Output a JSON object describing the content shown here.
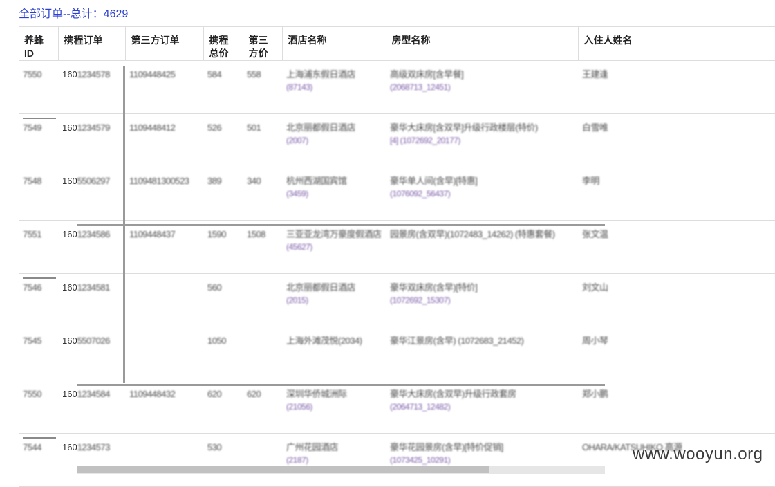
{
  "header": {
    "title_prefix": "全部订单--总计：",
    "total": "4629"
  },
  "table": {
    "columns": [
      {
        "key": "yf_id",
        "label": "养蜂ID"
      },
      {
        "key": "ctrip_order",
        "label": "携程订单"
      },
      {
        "key": "third_order",
        "label": "第三方订单"
      },
      {
        "key": "ctrip_total",
        "label": "携程总价"
      },
      {
        "key": "third_price",
        "label": "第三方价"
      },
      {
        "key": "hotel_name",
        "label": "酒店名称"
      },
      {
        "key": "room_type",
        "label": "房型名称"
      },
      {
        "key": "guest_name",
        "label": "入住人姓名"
      }
    ],
    "rows": [
      {
        "yf_id": "7550",
        "ctrip_prefix": "160",
        "ctrip_rest": "1234578",
        "third_order": "1109448425",
        "ctrip_total": "584",
        "third_price": "558",
        "hotel_name": "上海浦东假日酒店",
        "hotel_sub": "(87143)",
        "room_type": "高级双床房[含早餐]",
        "room_sub": "(2068713_12451)",
        "guest_name": "王建逢"
      },
      {
        "yf_id": "7549",
        "ctrip_prefix": "160",
        "ctrip_rest": "1234579",
        "third_order": "1109448412",
        "ctrip_total": "526",
        "third_price": "501",
        "hotel_name": "北京丽都假日酒店",
        "hotel_sub": "(2007)",
        "room_type": "豪华大床房[含双早]升级行政楼层(特价)",
        "room_sub": "[4] (1072692_20177)",
        "guest_name": "白雪唯"
      },
      {
        "yf_id": "7548",
        "ctrip_prefix": "160",
        "ctrip_rest": "5506297",
        "third_order": "1109481300523",
        "ctrip_total": "389",
        "third_price": "340",
        "hotel_name": "杭州西湖国宾馆",
        "hotel_sub": "(3459)",
        "room_type": "豪华单人间(含早)[特惠]",
        "room_sub": "(1076092_56437)",
        "guest_name": "李明"
      },
      {
        "yf_id": "7551",
        "ctrip_prefix": "160",
        "ctrip_rest": "1234586",
        "third_order": "1109448437",
        "ctrip_total": "1590",
        "third_price": "1508",
        "hotel_name": "三亚亚龙湾万豪度假酒店",
        "hotel_sub": "(45627)",
        "room_type": "园景房(含双早)(1072483_14262) (特惠套餐)",
        "room_sub": "",
        "guest_name": "张文温"
      },
      {
        "yf_id": "7546",
        "ctrip_prefix": "160",
        "ctrip_rest": "1234581",
        "third_order": "",
        "ctrip_total": "560",
        "third_price": "",
        "hotel_name": "北京丽都假日酒店",
        "hotel_sub": "(2015)",
        "room_type": "豪华双床房(含早)[特价]",
        "room_sub": "(1072692_15307)",
        "guest_name": "刘文山"
      },
      {
        "yf_id": "7545",
        "ctrip_prefix": "160",
        "ctrip_rest": "5507026",
        "third_order": "",
        "ctrip_total": "1050",
        "third_price": "",
        "hotel_name": "上海外滩茂悦(2034)",
        "hotel_sub": "",
        "room_type": "豪华江景房(含早) (1072683_21452)",
        "room_sub": "",
        "guest_name": "周小琴"
      },
      {
        "yf_id": "7550",
        "ctrip_prefix": "160",
        "ctrip_rest": "1234584",
        "third_order": "1109448432",
        "ctrip_total": "620",
        "third_price": "620",
        "hotel_name": "深圳华侨城洲际",
        "hotel_sub": "(21056)",
        "room_type": "豪华大床房(含双早)升级行政套房",
        "room_sub": "(2064713_12482)",
        "guest_name": "郑小鹏"
      },
      {
        "yf_id": "7544",
        "ctrip_prefix": "160",
        "ctrip_rest": "1234573",
        "third_order": "",
        "ctrip_total": "530",
        "third_price": "",
        "hotel_name": "广州花园酒店",
        "hotel_sub": "(2187)",
        "room_type": "豪华花园景房(含早)[特价促销]",
        "room_sub": "(1073425_10291)",
        "guest_name": "OHARA/KATSUHIKO 高源"
      }
    ]
  },
  "watermark": "www.wooyun.org"
}
